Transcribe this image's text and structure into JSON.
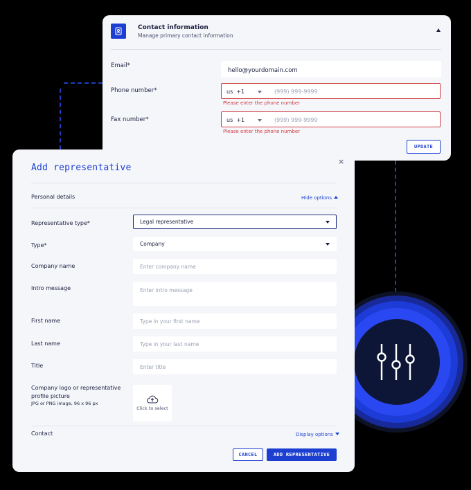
{
  "contact_card": {
    "title": "Contact information",
    "subtitle": "Manage primary contact information",
    "icon": "contact-card-icon",
    "email": {
      "label": "Email*",
      "value": "hello@yourdomain.com"
    },
    "phone": {
      "label": "Phone number*",
      "country": "us",
      "dial_code": "+1",
      "placeholder": "(999) 999-9999",
      "error": "Please enter the phone number"
    },
    "fax": {
      "label": "Fax number*",
      "country": "us",
      "dial_code": "+1",
      "placeholder": "(999) 999-9999",
      "error": "Please enter the phone number"
    },
    "update_label": "UPDATE"
  },
  "rep_card": {
    "title": "Add representative",
    "close_symbol": "×",
    "personal_section": {
      "label": "Personal details",
      "toggle": "Hide options"
    },
    "fields": {
      "rep_type": {
        "label": "Representative type*",
        "value": "Legal representative"
      },
      "type": {
        "label": "Type*",
        "value": "Company"
      },
      "company_name": {
        "label": "Company name",
        "placeholder": "Enter company name"
      },
      "intro_message": {
        "label": "Intro message",
        "placeholder": "Enter intro message"
      },
      "first_name": {
        "label": "First name",
        "placeholder": "Type in your first name"
      },
      "last_name": {
        "label": "Last name",
        "placeholder": "Type in your last name"
      },
      "title": {
        "label": "Title",
        "placeholder": "Enter title"
      },
      "logo": {
        "label": "Company logo or representative profile picture",
        "note": "JPG or PNG image, 96 x 96 px",
        "upload_text": "Click to select"
      }
    },
    "contact_section": {
      "label": "Contact",
      "toggle": "Display options"
    },
    "cancel_label": "CANCEL",
    "add_label": "ADD REPRESENTATIVE"
  },
  "colors": {
    "accent": "#1d3fd1",
    "error": "#cf3b43",
    "card_bg": "#f4f6fa",
    "background": "#000000"
  },
  "decoration": {
    "icon": "sliders-icon"
  }
}
